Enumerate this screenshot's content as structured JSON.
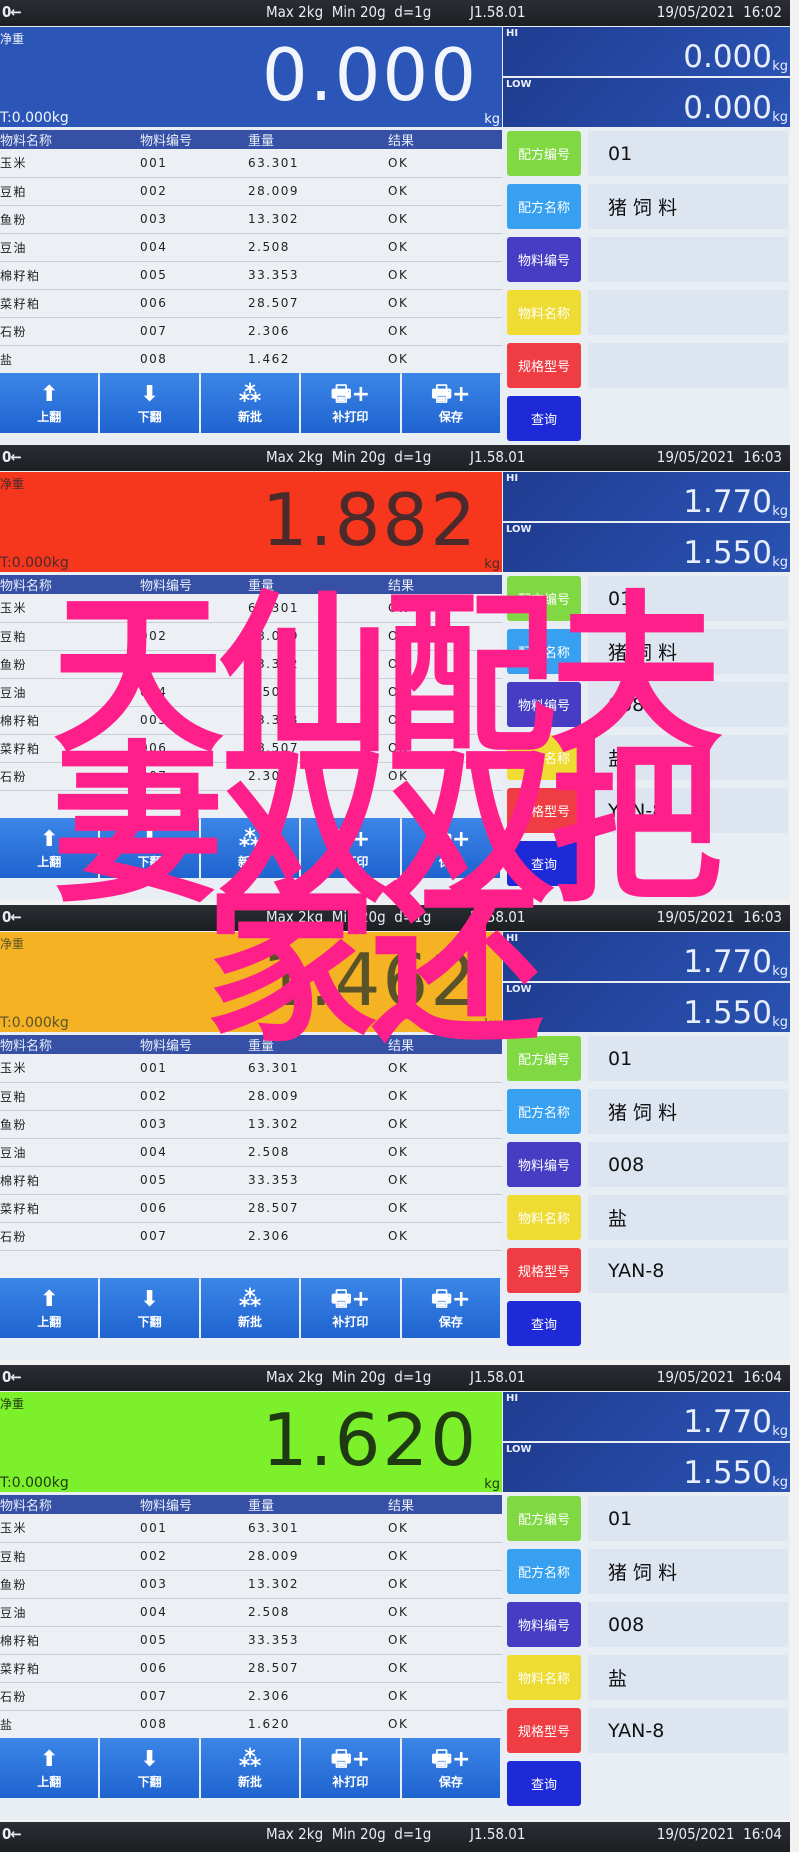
{
  "status": {
    "zero_icon": "zero-arrow-stable-icon",
    "zero_text": "0←",
    "spec": "Max 2kg  Min 20g  d=1g",
    "version": "J1.58.01"
  },
  "labels": {
    "net": "净重",
    "unit": "kg",
    "hi": "HI",
    "low": "LOW"
  },
  "table_headers": [
    "物料名称",
    "物料编号",
    "重量",
    "结果"
  ],
  "side_buttons": [
    {
      "label": "配方编号",
      "color": "#7bd83a"
    },
    {
      "label": "配方名称",
      "color": "#2f9cf0"
    },
    {
      "label": "物料编号",
      "color": "#3f34c2"
    },
    {
      "label": "物料名称",
      "color": "#f0dc28"
    },
    {
      "label": "规格型号",
      "color": "#f0343a"
    },
    {
      "label": "查询",
      "color": "#1420d6"
    }
  ],
  "toolbar": [
    {
      "label": "上翻",
      "icon": "arrow-up-icon"
    },
    {
      "label": "下翻",
      "icon": "arrow-down-icon"
    },
    {
      "label": "新批",
      "icon": "batch-stack-icon"
    },
    {
      "label": "补打印",
      "icon": "printer-plus-icon"
    },
    {
      "label": "保存",
      "icon": "printer-plus-icon"
    }
  ],
  "panels": [
    {
      "datetime": "19/05/2021  16:02",
      "weight": "0.000",
      "tare": "T:0.000kg",
      "bg": "#2c55b8",
      "fg": "#f2f5fb",
      "hi": "0.000",
      "low": "0.000",
      "rows": [
        [
          "玉米",
          "001",
          "63.301",
          "OK"
        ],
        [
          "豆粕",
          "002",
          "28.009",
          "OK"
        ],
        [
          "鱼粉",
          "003",
          "13.302",
          "OK"
        ],
        [
          "豆油",
          "004",
          "2.508",
          "OK"
        ],
        [
          "棉籽粕",
          "005",
          "33.353",
          "OK"
        ],
        [
          "菜籽粕",
          "006",
          "28.507",
          "OK"
        ],
        [
          "石粉",
          "007",
          "2.306",
          "OK"
        ],
        [
          "盐",
          "008",
          "1.462",
          "OK"
        ]
      ],
      "values": [
        "01",
        "猪 饲 料",
        "",
        "",
        "",
        ""
      ]
    },
    {
      "datetime": "19/05/2021  16:03",
      "weight": "1.882",
      "tare": "T:0.000kg",
      "bg": "#f7361e",
      "fg": "#4a2a2a",
      "hi": "1.770",
      "low": "1.550",
      "rows": [
        [
          "玉米",
          "001",
          "63.301",
          "OK"
        ],
        [
          "豆粕",
          "002",
          "28.009",
          "OK"
        ],
        [
          "鱼粉",
          "003",
          "13.302",
          "OK"
        ],
        [
          "豆油",
          "004",
          "2.508",
          "OK"
        ],
        [
          "棉籽粕",
          "005",
          "33.353",
          "OK"
        ],
        [
          "菜籽粕",
          "006",
          "28.507",
          "OK"
        ],
        [
          "石粉",
          "007",
          "2.306",
          "OK"
        ],
        [
          "",
          "",
          "",
          ""
        ]
      ],
      "values": [
        "01",
        "猪 饲 料",
        "008",
        "盐",
        "YAN-8",
        ""
      ]
    },
    {
      "datetime": "19/05/2021  16:03",
      "weight": "1.462",
      "tare": "T:0.000kg",
      "bg": "#f5b324",
      "fg": "#5a5228",
      "hi": "1.770",
      "low": "1.550",
      "rows": [
        [
          "玉米",
          "001",
          "63.301",
          "OK"
        ],
        [
          "豆粕",
          "002",
          "28.009",
          "OK"
        ],
        [
          "鱼粉",
          "003",
          "13.302",
          "OK"
        ],
        [
          "豆油",
          "004",
          "2.508",
          "OK"
        ],
        [
          "棉籽粕",
          "005",
          "33.353",
          "OK"
        ],
        [
          "菜籽粕",
          "006",
          "28.507",
          "OK"
        ],
        [
          "石粉",
          "007",
          "2.306",
          "OK"
        ],
        [
          "",
          "",
          "",
          ""
        ]
      ],
      "values": [
        "01",
        "猪 饲 料",
        "008",
        "盐",
        "YAN-8",
        ""
      ]
    },
    {
      "datetime": "19/05/2021  16:04",
      "weight": "1.620",
      "tare": "T:0.000kg",
      "bg": "#7cf02a",
      "fg": "#1f3a12",
      "hi": "1.770",
      "low": "1.550",
      "rows": [
        [
          "玉米",
          "001",
          "63.301",
          "OK"
        ],
        [
          "豆粕",
          "002",
          "28.009",
          "OK"
        ],
        [
          "鱼粉",
          "003",
          "13.302",
          "OK"
        ],
        [
          "豆油",
          "004",
          "2.508",
          "OK"
        ],
        [
          "棉籽粕",
          "005",
          "33.353",
          "OK"
        ],
        [
          "菜籽粕",
          "006",
          "28.507",
          "OK"
        ],
        [
          "石粉",
          "007",
          "2.306",
          "OK"
        ],
        [
          "盐",
          "008",
          "1.620",
          "OK"
        ]
      ],
      "values": [
        "01",
        "猪 饲 料",
        "008",
        "盐",
        "YAN-8",
        ""
      ]
    }
  ],
  "final_status": {
    "datetime": "19/05/2021  16:04"
  },
  "overlay_text": {
    "line1": "天仙配夫",
    "line2": "妻双双把",
    "line3": "家还"
  }
}
